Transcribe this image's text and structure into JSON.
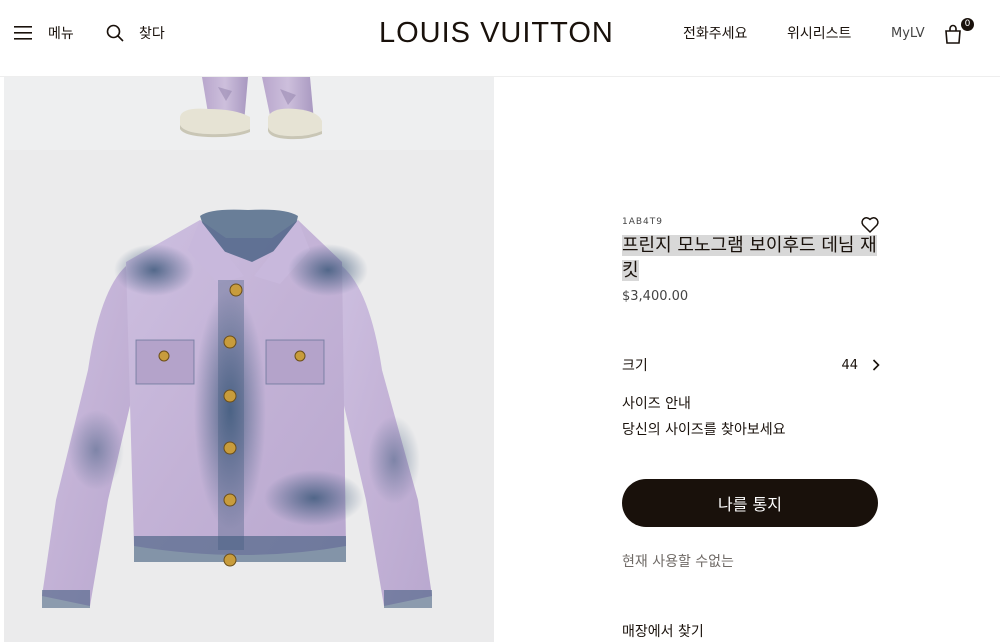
{
  "header": {
    "menu_label": "메뉴",
    "search_label": "찾다",
    "logo": "LOUIS VUITTON",
    "call_label": "전화주세요",
    "wishlist_label": "위시리스트",
    "mylv_label": "MyLV",
    "bag_count": "0"
  },
  "product": {
    "sku": "1AB4T9",
    "title": "프린지 모노그램 보이후드 데님 재킷",
    "price": "$3,400.00",
    "size_label": "크기",
    "size_value": "44",
    "size_guide": "사이즈 안내",
    "size_finder": "당신의 사이즈를 찾아보세요",
    "notify_button": "나를 통지",
    "availability": "현재 사용할 수없는",
    "find_in_store": "매장에서 찾기"
  },
  "colors": {
    "brand_dark": "#19110b",
    "jacket_lilac": "#c3b2d6",
    "indigo_wash": "#3e5a7c"
  }
}
